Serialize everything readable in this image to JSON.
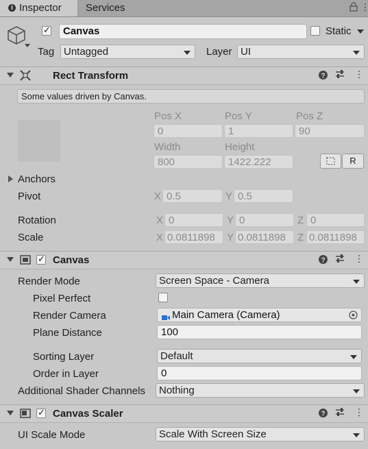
{
  "tabs": [
    {
      "label": "Inspector"
    },
    {
      "label": "Services"
    }
  ],
  "object": {
    "name": "Canvas",
    "static_label": "Static",
    "tag_label": "Tag",
    "tag_value": "Untagged",
    "layer_label": "Layer",
    "layer_value": "UI"
  },
  "rect_transform": {
    "title": "Rect Transform",
    "info": "Some values driven by Canvas.",
    "pos_x_label": "Pos X",
    "pos_y_label": "Pos Y",
    "pos_z_label": "Pos Z",
    "pos_x": "0",
    "pos_y": "1",
    "pos_z": "90",
    "width_label": "Width",
    "height_label": "Height",
    "width": "800",
    "height": "1422.222",
    "r_button": "R",
    "anchors_label": "Anchors",
    "pivot_label": "Pivot",
    "pivot_x": "0.5",
    "pivot_y": "0.5",
    "rotation_label": "Rotation",
    "rot_x": "0",
    "rot_y": "0",
    "rot_z": "0",
    "scale_label": "Scale",
    "scale_x": "0.0811898",
    "scale_y": "0.0811898",
    "scale_z": "0.0811898",
    "x": "X",
    "y": "Y",
    "z": "Z"
  },
  "canvas": {
    "title": "Canvas",
    "render_mode_label": "Render Mode",
    "render_mode": "Screen Space - Camera",
    "pixel_perfect_label": "Pixel Perfect",
    "render_camera_label": "Render Camera",
    "render_camera": "Main Camera (Camera)",
    "plane_distance_label": "Plane Distance",
    "plane_distance": "100",
    "sorting_layer_label": "Sorting Layer",
    "sorting_layer": "Default",
    "order_label": "Order in Layer",
    "order": "0",
    "shader_label": "Additional Shader Channels",
    "shader": "Nothing"
  },
  "scaler": {
    "title": "Canvas Scaler",
    "mode_label": "UI Scale Mode",
    "mode": "Scale With Screen Size"
  }
}
